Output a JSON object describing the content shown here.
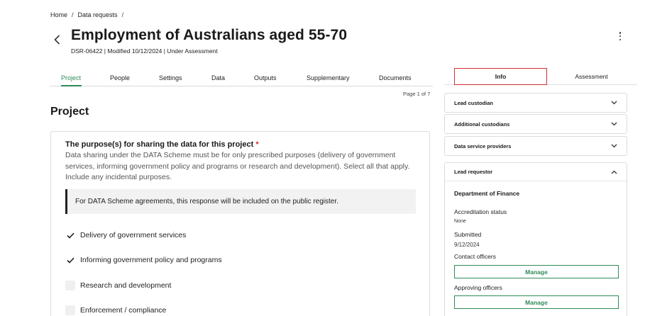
{
  "breadcrumb": {
    "items": [
      "Home",
      "Data requests"
    ],
    "separator": "/"
  },
  "page": {
    "title": "Employment of Australians aged 55-70",
    "subtitle": "DSR-06422 | Modified 10/12/2024 | Under Assessment"
  },
  "tabs": [
    {
      "label": "Project",
      "active": true
    },
    {
      "label": "People"
    },
    {
      "label": "Settings"
    },
    {
      "label": "Data"
    },
    {
      "label": "Outputs"
    },
    {
      "label": "Supplementary"
    },
    {
      "label": "Documents"
    }
  ],
  "pagination": "Page 1 of 7",
  "section_title": "Project",
  "question": {
    "label": "The purpose(s) for sharing the data for this project",
    "required_mark": "*",
    "help": "Data sharing under the DATA Scheme must be for only prescribed purposes (delivery of government services, informing government policy and programs or research and development). Select all that apply. Include any incidental purposes.",
    "notice": "For DATA Scheme agreements, this response will be included on the public register.",
    "options": [
      {
        "label": "Delivery of government services",
        "checked": true
      },
      {
        "label": "Informing government policy and programs",
        "checked": true
      },
      {
        "label": "Research and development",
        "checked": false
      },
      {
        "label": "Enforcement / compliance",
        "checked": false
      }
    ]
  },
  "side_panel": {
    "tabs": [
      {
        "label": "Info",
        "active": true
      },
      {
        "label": "Assessment"
      }
    ],
    "accordions": [
      {
        "label": "Lead custodian"
      },
      {
        "label": "Additional custodians"
      },
      {
        "label": "Data service providers"
      }
    ],
    "lead_requestor": {
      "label": "Lead requestor",
      "organisation": "Department of Finance",
      "accreditation_label": "Accreditation status",
      "accreditation_value": "None",
      "submitted_label": "Submitted",
      "submitted_value": "9/12/2024",
      "contact_label": "Contact officers",
      "approving_label": "Approving officers",
      "manage_label": "Manage"
    }
  },
  "colors": {
    "accent": "#2e8b57",
    "highlight": "#d32f2f",
    "required": "#d32f2f"
  }
}
